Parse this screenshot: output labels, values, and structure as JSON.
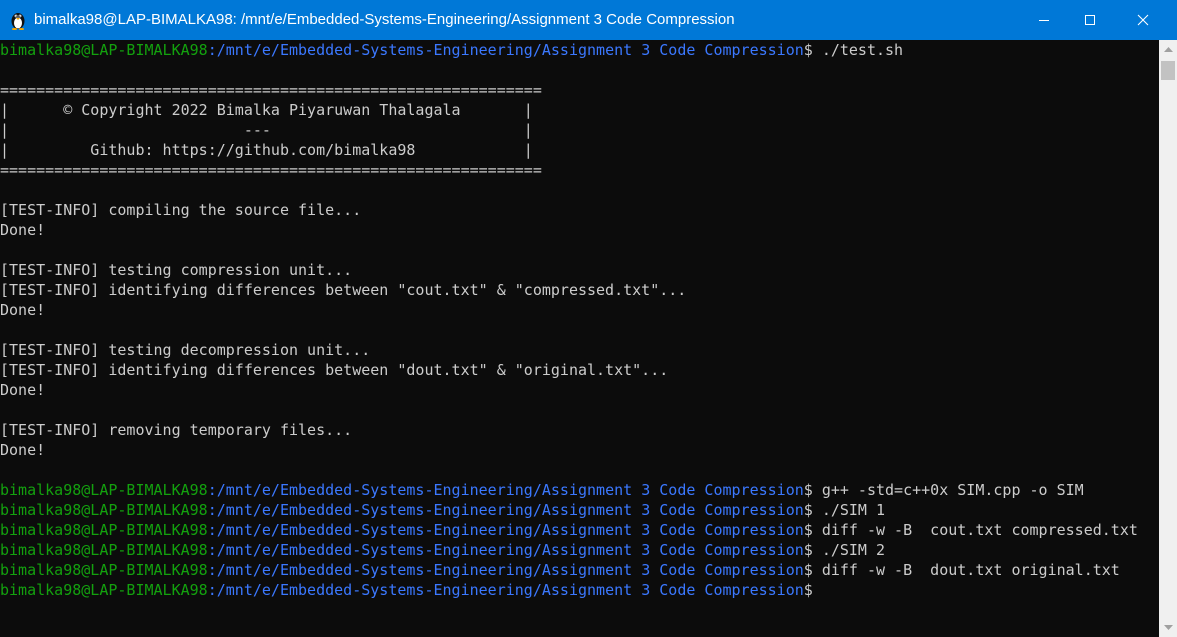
{
  "window": {
    "title": "bimalka98@LAP-BIMALKA98: /mnt/e/Embedded-Systems-Engineering/Assignment 3 Code Compression",
    "app_icon": "linux-penguin-icon",
    "controls": [
      "minimize-icon",
      "maximize-icon",
      "close-icon"
    ]
  },
  "prompt": {
    "user": "bimalka98@LAP-BIMALKA98",
    "path": ":/mnt/e/Embedded-Systems-Engineering/Assignment 3 Code Compression",
    "symbol": "$ "
  },
  "lines": [
    {
      "type": "prompt",
      "cmd": "./test.sh"
    },
    {
      "type": "text",
      "text": ""
    },
    {
      "type": "text",
      "text": "============================================================"
    },
    {
      "type": "text",
      "text": "|      © Copyright 2022 Bimalka Piyaruwan Thalagala       |"
    },
    {
      "type": "text",
      "text": "|                          ---                            |"
    },
    {
      "type": "text",
      "text": "|         Github: https://github.com/bimalka98            |"
    },
    {
      "type": "text",
      "text": "============================================================"
    },
    {
      "type": "text",
      "text": ""
    },
    {
      "type": "text",
      "text": "[TEST-INFO] compiling the source file..."
    },
    {
      "type": "text",
      "text": "Done!"
    },
    {
      "type": "text",
      "text": ""
    },
    {
      "type": "text",
      "text": "[TEST-INFO] testing compression unit..."
    },
    {
      "type": "text",
      "text": "[TEST-INFO] identifying differences between \"cout.txt\" & \"compressed.txt\"..."
    },
    {
      "type": "text",
      "text": "Done!"
    },
    {
      "type": "text",
      "text": ""
    },
    {
      "type": "text",
      "text": "[TEST-INFO] testing decompression unit..."
    },
    {
      "type": "text",
      "text": "[TEST-INFO] identifying differences between \"dout.txt\" & \"original.txt\"..."
    },
    {
      "type": "text",
      "text": "Done!"
    },
    {
      "type": "text",
      "text": ""
    },
    {
      "type": "text",
      "text": "[TEST-INFO] removing temporary files..."
    },
    {
      "type": "text",
      "text": "Done!"
    },
    {
      "type": "text",
      "text": ""
    },
    {
      "type": "prompt",
      "cmd": "g++ -std=c++0x SIM.cpp -o SIM"
    },
    {
      "type": "prompt",
      "cmd": "./SIM 1"
    },
    {
      "type": "prompt",
      "cmd": "diff -w -B  cout.txt compressed.txt"
    },
    {
      "type": "prompt",
      "cmd": "./SIM 2"
    },
    {
      "type": "prompt",
      "cmd": "diff -w -B  dout.txt original.txt"
    },
    {
      "type": "prompt",
      "cmd": ""
    }
  ],
  "colors": {
    "titlebar": "#0078d7",
    "terminal_bg": "#0c0c0c",
    "text": "#cccccc",
    "user": "#13a10e",
    "path": "#3b78ff"
  }
}
